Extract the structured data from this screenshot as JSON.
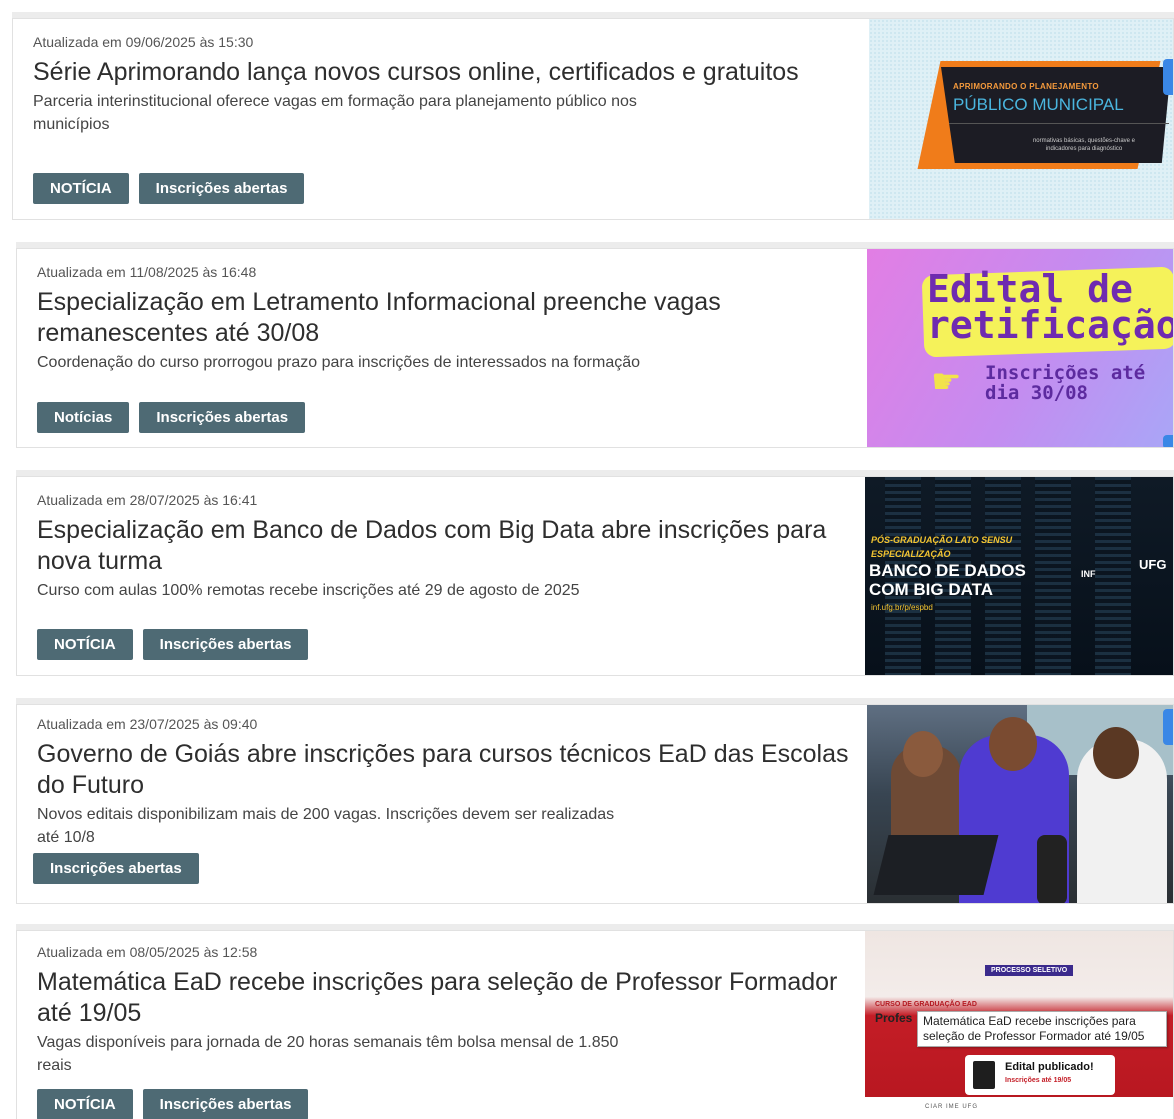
{
  "news": [
    {
      "updated": "Atualizada em 09/06/2025 às 15:30",
      "title": "Série Aprimorando lança novos cursos online, certificados e gratuitos",
      "summary": "Parceria interinstitucional oferece vagas em formação para planejamento público nos municípios",
      "tags": [
        "NOTÍCIA",
        "Inscrições abertas"
      ],
      "image": {
        "line1": "APRIMORANDO O PLANEJAMENTO",
        "line2": "PÚBLICO MUNICIPAL",
        "line3": "normativas básicas, questões-chave e indicadores para diagnóstico"
      }
    },
    {
      "updated": "Atualizada em 11/08/2025 às 16:48",
      "title": "Especialização em Letramento Informacional preenche vagas remanescentes até 30/08",
      "summary": "Coordenação do curso prorrogou prazo para inscrições de interessados na formação",
      "tags": [
        "Notícias",
        "Inscrições abertas"
      ],
      "image": {
        "heading": "Edital de retificação",
        "sub": "Inscrições até dia 30/08",
        "hand": "☛"
      }
    },
    {
      "updated": "Atualizada em 28/07/2025 às 16:41",
      "title": "Especialização em Banco de Dados com Big Data abre inscrições para nova turma",
      "summary": "Curso com aulas 100% remotas recebe inscrições até 29 de agosto de 2025",
      "tags": [
        "NOTÍCIA",
        "Inscrições abertas"
      ],
      "image": {
        "line1": "PÓS-GRADUAÇÃO LATO SENSU",
        "line2": "ESPECIALIZAÇÃO",
        "line3": "BANCO DE DADOS COM BIG DATA",
        "line4": "inf.ufg.br/p/espbd",
        "inf": "INF",
        "ufg": "UFG"
      }
    },
    {
      "updated": "Atualizada em 23/07/2025 às 09:40",
      "title": "Governo de Goiás abre inscrições para cursos técnicos EaD das Escolas do Futuro",
      "summary": "Novos editais disponibilizam mais de 200 vagas. Inscrições devem ser realizadas até 10/8",
      "tags": [
        "Inscrições abertas"
      ]
    },
    {
      "updated": "Atualizada em 08/05/2025 às 12:58",
      "title": "Matemática EaD recebe inscrições para seleção de Professor Formador até 19/05",
      "summary": "Vagas disponíveis para jornada de 20 horas semanais têm bolsa mensal de 1.850 reais",
      "tags": [
        "NOTÍCIA",
        "Inscrições abertas"
      ],
      "image": {
        "badge": "PROCESSO SELETIVO",
        "course": "CURSO DE GRADUAÇÃO EAD",
        "prof": "Profes",
        "tooltip": "Matemática EaD recebe inscrições para seleção de Professor Formador até 19/05",
        "pub1": "Edital publicado!",
        "pub2": "Inscrições até 19/05",
        "logos": "CIAR IME UFG"
      }
    }
  ]
}
